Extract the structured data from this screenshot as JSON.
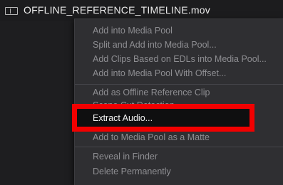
{
  "file_row": {
    "icon": "film-clip-icon",
    "filename": "OFFLINE_REFERENCE_TIMELINE.mov"
  },
  "context_menu": {
    "group1": [
      "Add into Media Pool",
      "Split and Add into Media Pool...",
      "Add Clips Based on EDLs into Media Pool...",
      "Add into Media Pool With Offset..."
    ],
    "group2": [
      "Add as Offline Reference Clip",
      "Scene Cut Detection..."
    ],
    "extract_audio": "Extract Audio...",
    "group3": [
      "Add to Media Pool as a Matte"
    ],
    "group4": [
      "Reveal in Finder",
      "Delete Permanently"
    ]
  },
  "colors": {
    "highlight_border": "#f20000",
    "menu_background": "#2f2f32",
    "disabled_text": "#8e8e92",
    "enabled_text": "#f4f4f4"
  }
}
